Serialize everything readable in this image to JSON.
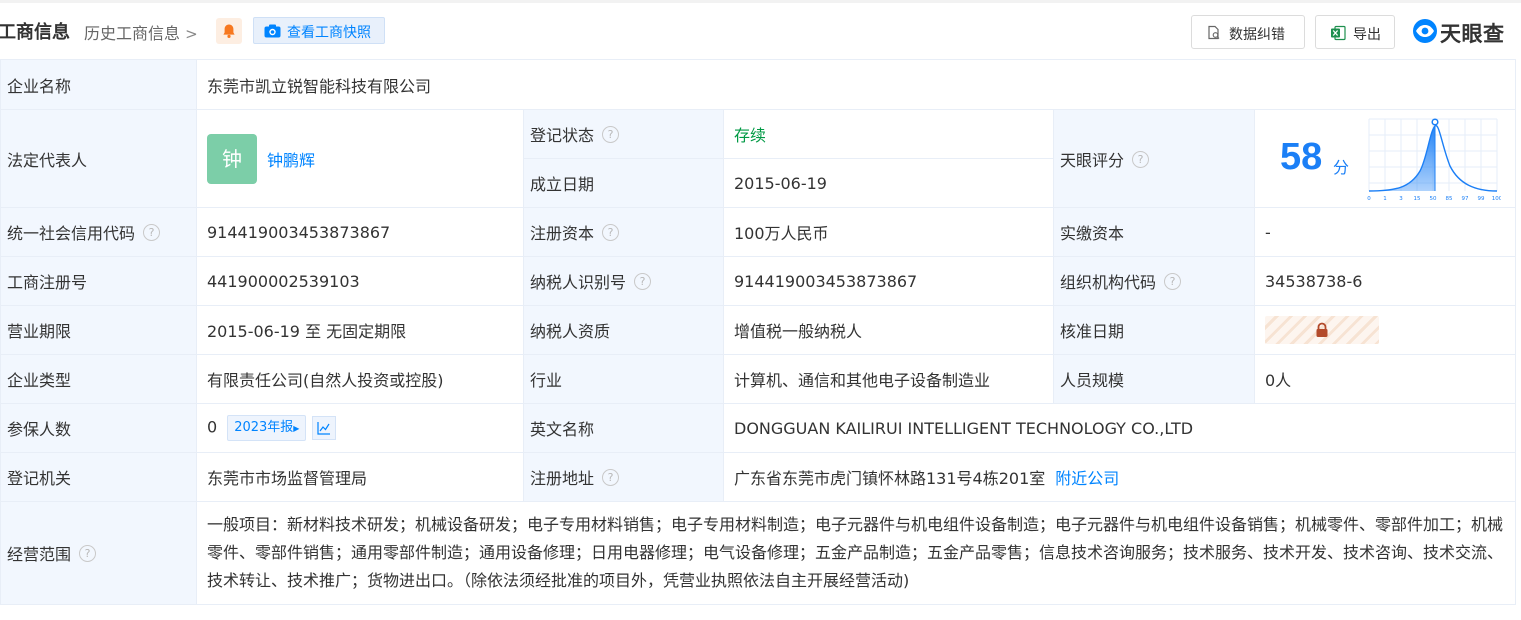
{
  "header": {
    "title": "工商信息",
    "history_link": "历史工商信息",
    "snapshot_button": "查看工商快照",
    "data_fix_button": "数据纠错",
    "export_button": "导出",
    "logo_text": "天眼查"
  },
  "info": {
    "company_name_label": "企业名称",
    "company_name": "东莞市凯立锐智能科技有限公司",
    "legal_rep_label": "法定代表人",
    "legal_rep_avatar_char": "钟",
    "legal_rep_name": "钟鹏辉",
    "reg_status_label": "登记状态",
    "reg_status": "存续",
    "found_date_label": "成立日期",
    "found_date": "2015-06-19",
    "score_label": "天眼评分",
    "score_value": "58",
    "score_unit": "分",
    "score_axis_ticks": [
      "0",
      "1",
      "3",
      "15",
      "50",
      "85",
      "97",
      "99",
      "100"
    ],
    "credit_code_label": "统一社会信用代码",
    "credit_code": "914419003453873867",
    "reg_capital_label": "注册资本",
    "reg_capital": "100万人民币",
    "paid_capital_label": "实缴资本",
    "paid_capital": "-",
    "biz_reg_no_label": "工商注册号",
    "biz_reg_no": "441900002539103",
    "taxpayer_id_label": "纳税人识别号",
    "taxpayer_id": "914419003453873867",
    "org_code_label": "组织机构代码",
    "org_code": "34538738-6",
    "biz_term_label": "营业期限",
    "biz_term": "2015-06-19 至 无固定期限",
    "taxpayer_qual_label": "纳税人资质",
    "taxpayer_qual": "增值税一般纳税人",
    "approval_date_label": "核准日期",
    "company_type_label": "企业类型",
    "company_type": "有限责任公司(自然人投资或控股)",
    "industry_label": "行业",
    "industry": "计算机、通信和其他电子设备制造业",
    "staff_size_label": "人员规模",
    "staff_size": "0人",
    "insured_label": "参保人数",
    "insured_count": "0",
    "insured_year_tag": "2023年报",
    "english_name_label": "英文名称",
    "english_name": "DONGGUAN KAILIRUI INTELLIGENT TECHNOLOGY CO.,LTD",
    "reg_authority_label": "登记机关",
    "reg_authority": "东莞市市场监督管理局",
    "reg_address_label": "注册地址",
    "reg_address": "广东省东莞市虎门镇怀林路131号4栋201室",
    "nearby_link": "附近公司",
    "scope_label": "经营范围",
    "scope": "一般项目：新材料技术研发；机械设备研发；电子专用材料销售；电子专用材料制造；电子元器件与机电组件设备制造；电子元器件与机电组件设备销售；机械零件、零部件加工；机械零件、零部件销售；通用零部件制造；通用设备修理；日用电器修理；电气设备修理；五金产品制造；五金产品零售；信息技术咨询服务；技术服务、技术开发、技术咨询、技术交流、技术转让、技术推广；货物进出口。（除依法须经批准的项目外，凭营业执照依法自主开展经营活动)"
  },
  "colors": {
    "link": "#0084ff",
    "status_active": "#009944",
    "label_bg": "#f2f7fe",
    "score": "#1b7ff6",
    "avatar_bg": "#7ccea8"
  }
}
